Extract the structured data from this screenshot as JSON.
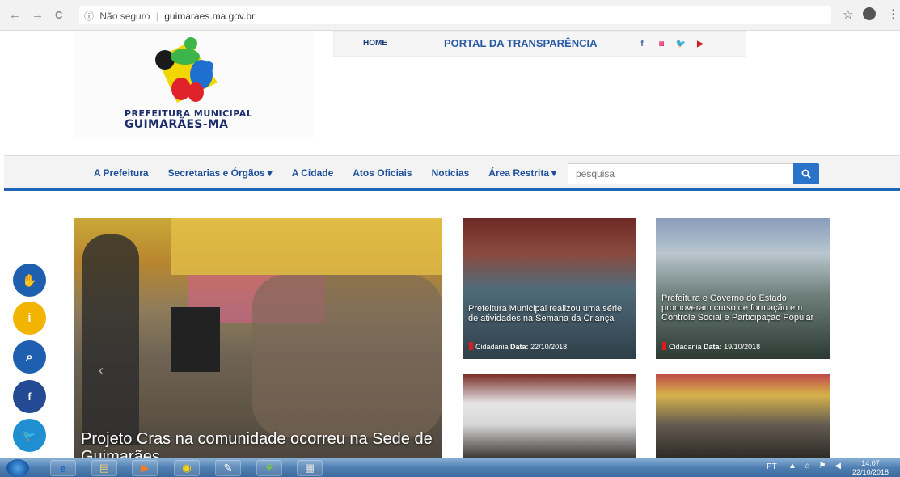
{
  "browser": {
    "back": "←",
    "forward": "→",
    "reload": "C",
    "info_icon": "ⓘ",
    "security": "Não seguro",
    "separator": "|",
    "url": "guimaraes.ma.gov.br",
    "star": "☆",
    "menu": "⋮"
  },
  "header": {
    "logo_line1": "PREFEITURA MUNICIPAL",
    "logo_line2": "GUIMARÃES-MA",
    "home_link": "HOME",
    "transparency_link": "PORTAL DA TRANSPARÊNCIA",
    "social": {
      "facebook": "f",
      "instagram": "◙",
      "twitter": "🐦",
      "youtube": "▶"
    }
  },
  "nav": {
    "items": [
      {
        "label": "A Prefeitura"
      },
      {
        "label": "Secretarias e Órgãos"
      },
      {
        "label": "A Cidade"
      },
      {
        "label": "Atos Oficiais"
      },
      {
        "label": "Notícias"
      },
      {
        "label": "Área Restrita"
      }
    ],
    "caret": "▾",
    "search_placeholder": "pesquisa"
  },
  "featured": {
    "title": "Projeto Cras na comunidade ocorreu na Sede de Guimarães",
    "arrow": "‹"
  },
  "news": [
    {
      "title": "Prefeitura Municipal realizou uma série de atividades na Semana da Criança",
      "category": "Cidadania",
      "date_label": "Data:",
      "date": "22/10/2018"
    },
    {
      "title": "Prefeitura e Governo do Estado promoveram curso de formação em Controle Social e Participação Popular",
      "category": "Cidadania",
      "date_label": "Data:",
      "date": "19/10/2018"
    }
  ],
  "floating": {
    "accessibility": "✋",
    "info": "i",
    "search": "⌕",
    "facebook": "f",
    "twitter": "🐦"
  },
  "taskbar": {
    "lang": "PT",
    "tray_icons": "▲ ⌂ ⚑ ◀",
    "time": "14:07",
    "date": "22/10/2018",
    "apps": [
      "e",
      "▤",
      "▶",
      "◉",
      "✎",
      "⚘",
      "▦"
    ]
  }
}
